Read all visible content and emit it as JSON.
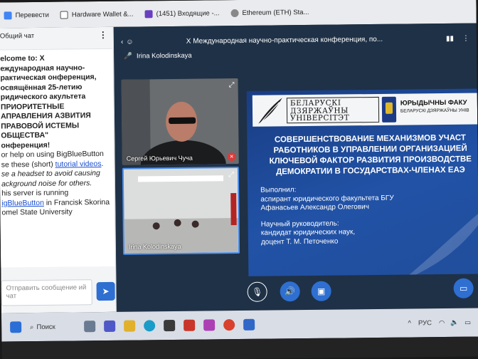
{
  "bookmarks": [
    {
      "label": "Перевести",
      "color": "#4285f4"
    },
    {
      "label": "Hardware Wallet &...",
      "color": "#555555"
    },
    {
      "label": "(1451) Входящие -...",
      "color": "#6a3fbf"
    },
    {
      "label": "Ethereum (ETH) Sta...",
      "color": "#888888"
    }
  ],
  "chat": {
    "title": "Общий чат",
    "welcome_prefix": "elcome to: X",
    "welcome_bold": "еждународная научно-рактическая онференция, освящённая 25-летию ридического акультета ПРИОРИТЕТНЫЕ АПРАВЛЕНИЯ АЗВИТИЯ ПРАВОВОЙ ИСТЕМЫ ОБЩЕСТВА\"",
    "welcome_end": "онференция!",
    "help_text_1": "or help on using BigBlueButton",
    "help_text_2": "se these (short)",
    "help_link": "tutorial videos",
    "headset_note": "se a headset to avoid causing ackground noise for others.",
    "server_1": "his server is running",
    "server_link": "igBlueButton",
    "server_2": "in Francisk Skorina omel State University",
    "input_placeholder": "Отправить сообщение ий чат"
  },
  "meeting": {
    "title": "X Международная научно-практическая конференция, по...",
    "presenter": "Irina Kolodinskaya"
  },
  "tiles": [
    {
      "name": "Сергей Юрьевич Чуча"
    },
    {
      "name": "Irina Kolodinskaya"
    }
  ],
  "slide": {
    "logo_line1": "БЕЛАРУСКІ",
    "logo_line2": "ДЗЯРЖАЎНЫ",
    "logo_line3": "УНІВЕРСІТЭТ",
    "faculty": "ЮРЫДЫЧНЫ ФАКУ",
    "faculty_sub": "БЕЛАРУСКІ ДЗЯРЖАЎНЫ УНІВ",
    "title_1": "СОВЕРШЕНСТВОВАНИЕ МЕХАНИЗМОВ УЧАСТ",
    "title_2": "РАБОТНИКОВ В УПРАВЛЕНИИ ОРГАНИЗАЦИЕЙ",
    "title_3": "КЛЮЧЕВОЙ ФАКТОР РАЗВИТИЯ ПРОИЗВОДСТВЕ",
    "title_4": "ДЕМОКРАТИИ В ГОСУДАРСТВАХ-ЧЛЕНАХ ЕАЭ",
    "done_label": "Выполнил:",
    "author_1": "аспирант юридического факультета БГУ",
    "author_2": "Афанасьев Александр Олегович",
    "advisor_label": "Научный руководитель:",
    "advisor_1": "кандидат юридических наук,",
    "advisor_2": "доцент Т. М. Петоченко"
  },
  "taskbar": {
    "search_label": "Поиск",
    "lang": "РУС"
  }
}
